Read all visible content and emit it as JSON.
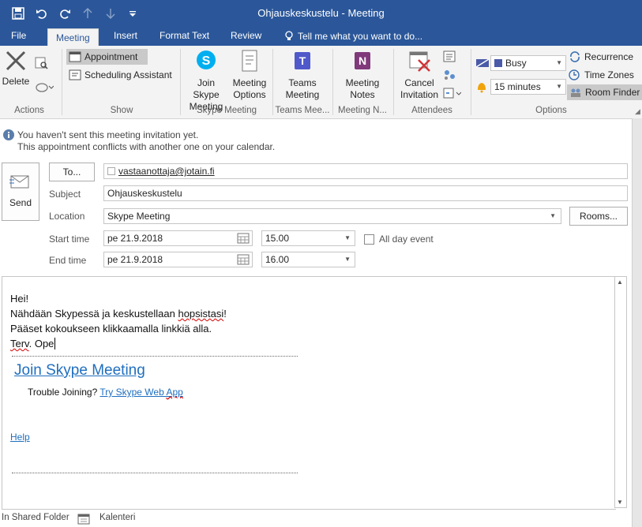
{
  "window": {
    "title": "Ohjauskeskustelu - Meeting"
  },
  "tabs": [
    "File",
    "Meeting",
    "Insert",
    "Format Text",
    "Review"
  ],
  "tell_me": "Tell me what you want to do...",
  "ribbon": {
    "actions": {
      "delete": "Delete",
      "group": "Actions"
    },
    "show": {
      "appointment": "Appointment",
      "scheduling": "Scheduling Assistant",
      "group": "Show"
    },
    "skype": {
      "join_1": "Join Skype",
      "join_2": "Meeting",
      "options_1": "Meeting",
      "options_2": "Options",
      "group": "Skype Meeting"
    },
    "teams": {
      "l1": "Teams",
      "l2": "Meeting",
      "group": "Teams Mee..."
    },
    "notes": {
      "l1": "Meeting",
      "l2": "Notes",
      "group": "Meeting N..."
    },
    "attendees": {
      "cancel_1": "Cancel",
      "cancel_2": "Invitation",
      "group": "Attendees"
    },
    "options": {
      "show_as": "Busy",
      "reminder": "15 minutes",
      "recurrence": "Recurrence",
      "time_zones": "Time Zones",
      "room_finder": "Room Finder",
      "group": "Options"
    }
  },
  "info": {
    "line1": "You haven't sent this meeting invitation yet.",
    "line2": "This appointment conflicts with another one on your calendar."
  },
  "form": {
    "send": "Send",
    "to_button": "To...",
    "to_value": "vastaanottaja@jotain.fi",
    "subject_label": "Subject",
    "subject_value": "Ohjauskeskustelu",
    "location_label": "Location",
    "location_value": "Skype Meeting",
    "rooms_button": "Rooms...",
    "start_label": "Start time",
    "start_date": "pe 21.9.2018",
    "start_time": "15.00",
    "all_day": "All day event",
    "end_label": "End time",
    "end_date": "pe 21.9.2018",
    "end_time": "16.00"
  },
  "body": {
    "line1": "Hei!",
    "line2_a": "Nähdään Skypessä ja keskustellaan ",
    "line2_b": "hopsistasi",
    "line2_c": "!",
    "line3": "Pääset kokoukseen klikkaamalla linkkiä alla.",
    "line4_a": "Terv",
    "line4_b": ". Ope",
    "join_link": "Join Skype Meeting",
    "trouble": "Trouble Joining?",
    "web_app_a": "Try Skype Web ",
    "web_app_b": "App",
    "help": "Help"
  },
  "status": {
    "shared": "In Shared Folder",
    "calendar": "Kalenteri"
  },
  "colors": {
    "accent": "#2b579a",
    "link": "#1f6fbf",
    "ribbon_bg": "#f3f3f3"
  }
}
